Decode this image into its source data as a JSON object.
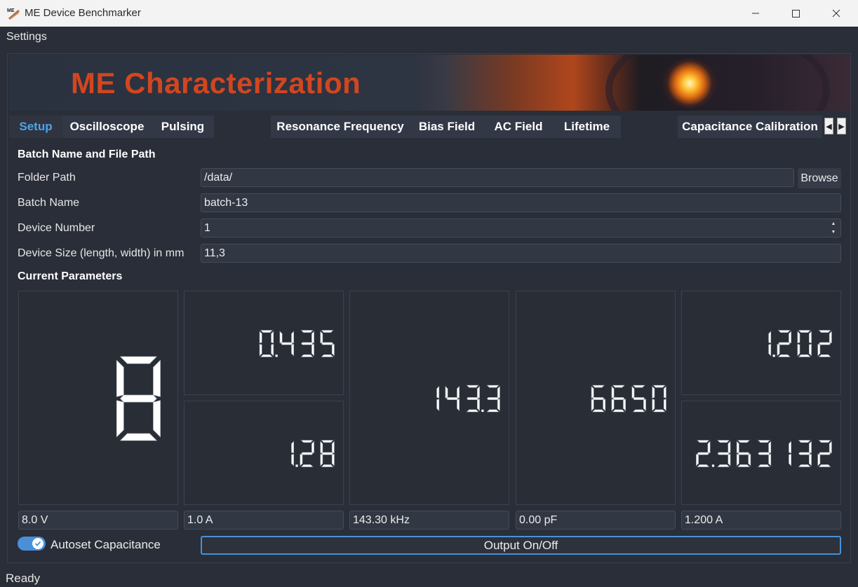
{
  "window": {
    "title": "ME Device Benchmarker",
    "icon_label": "ME"
  },
  "menu": {
    "settings": "Settings"
  },
  "banner": {
    "title": "ME Characterization"
  },
  "tabs": [
    "Setup",
    "Oscilloscope",
    "Pulsing",
    "Resonance Frequency",
    "Bias Field",
    "AC Field",
    "Lifetime",
    "Capacitance Calibration"
  ],
  "active_tab": "Setup",
  "setup": {
    "batch_section_title": "Batch Name and File Path",
    "folder_path_label": "Folder Path",
    "folder_path_value": "/data/",
    "browse_label": "Browse",
    "batch_name_label": "Batch Name",
    "batch_name_value": "batch-13",
    "device_number_label": "Device Number",
    "device_number_value": "1",
    "device_size_label": "Device Size (length, width) in mm",
    "device_size_value": "11,3",
    "current_params_title": "Current Parameters"
  },
  "lcd_displays": {
    "big": "8",
    "mid_top": "0.435",
    "mid_bottom": "1.28",
    "center": "143.3",
    "right_center": "6650",
    "right_top": "1.202",
    "right_bottom": "2.363132"
  },
  "value_fields": [
    "8.0 V",
    "1.0 A",
    "143.30 kHz",
    "0.00 pF",
    "1.200 A"
  ],
  "autoset": {
    "label": "Autoset Capacitance",
    "enabled": true
  },
  "output_button": "Output On/Off",
  "status": "Ready",
  "colors": {
    "accent": "#4a90d9",
    "active_tab": "#4ea4e8",
    "banner_title": "#d2461f",
    "background": "#2a2e38"
  }
}
